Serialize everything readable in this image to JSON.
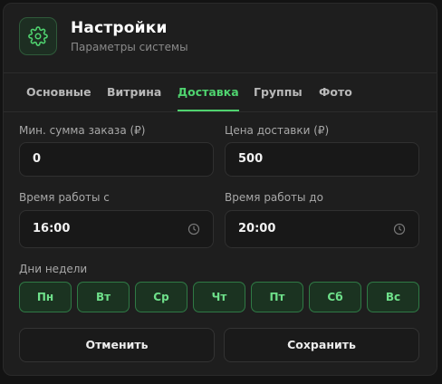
{
  "header": {
    "title": "Настройки",
    "subtitle": "Параметры системы",
    "icon": "gear-icon"
  },
  "tabs": [
    {
      "label": "Основные",
      "active": false
    },
    {
      "label": "Витрина",
      "active": false
    },
    {
      "label": "Доставка",
      "active": true
    },
    {
      "label": "Группы",
      "active": false
    },
    {
      "label": "Фото",
      "active": false
    }
  ],
  "form": {
    "min_order": {
      "label": "Мин. сумма заказа (₽)",
      "value": "0"
    },
    "delivery_price": {
      "label": "Цена доставки (₽)",
      "value": "500"
    },
    "work_from": {
      "label": "Время работы с",
      "value": "16:00",
      "icon": "clock-icon"
    },
    "work_to": {
      "label": "Время работы до",
      "value": "20:00",
      "icon": "clock-icon"
    },
    "days_label": "Дни недели",
    "days": [
      "Пн",
      "Вт",
      "Ср",
      "Чт",
      "Пт",
      "Сб",
      "Вс"
    ]
  },
  "actions": {
    "cancel": "Отменить",
    "save": "Сохранить"
  },
  "colors": {
    "accent": "#4fd36f",
    "background": "#1e1e1e"
  }
}
